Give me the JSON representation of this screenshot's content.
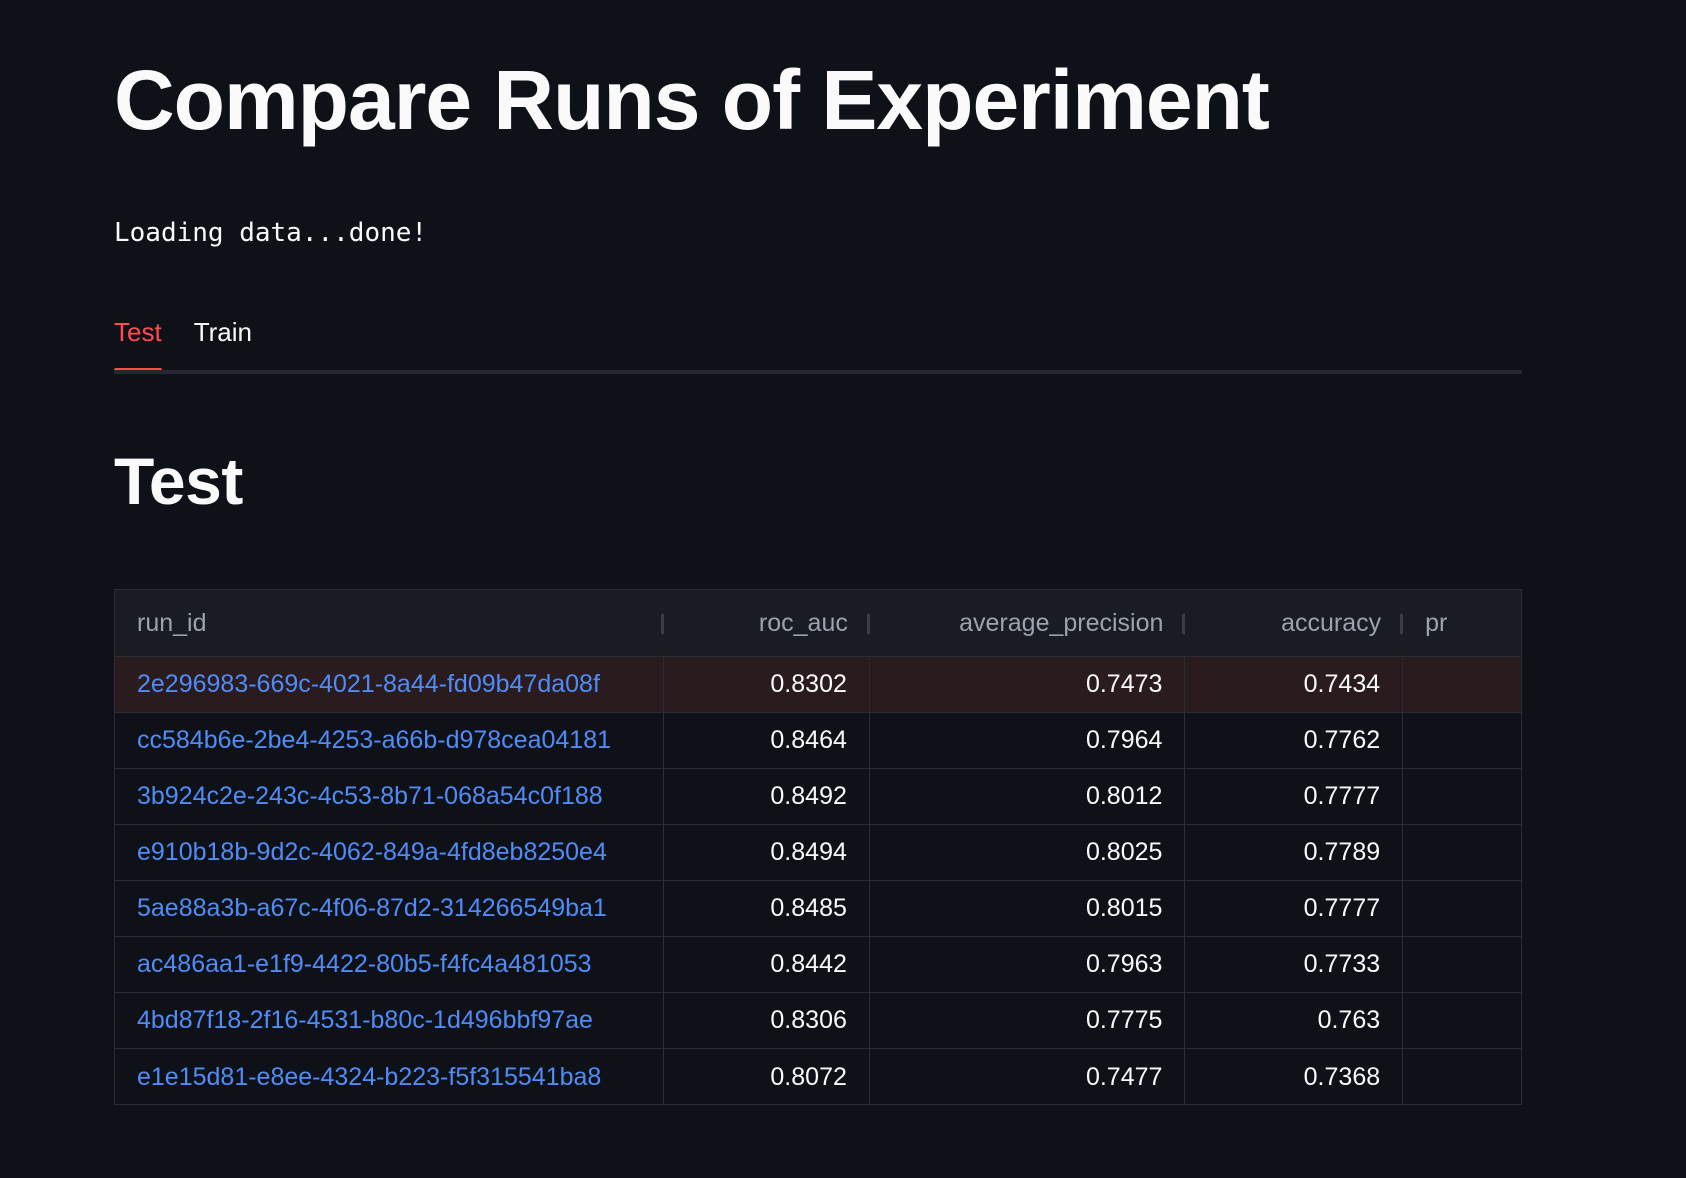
{
  "page": {
    "title": "Compare Runs of Experiment",
    "status": "Loading data...done!",
    "section_title": "Test"
  },
  "tabs": [
    {
      "label": "Test",
      "active": true
    },
    {
      "label": "Train",
      "active": false
    }
  ],
  "colors": {
    "background": "#0e1117",
    "accent": "#ff4b4b",
    "link": "#4f8cf7"
  },
  "table": {
    "columns": [
      "run_id",
      "roc_auc",
      "average_precision",
      "accuracy",
      "pr"
    ],
    "rows": [
      {
        "run_id": "2e296983-669c-4021-8a44-fd09b47da08f",
        "roc_auc": "0.8302",
        "average_precision": "0.7473",
        "accuracy": "0.7434"
      },
      {
        "run_id": "cc584b6e-2be4-4253-a66b-d978cea04181",
        "roc_auc": "0.8464",
        "average_precision": "0.7964",
        "accuracy": "0.7762"
      },
      {
        "run_id": "3b924c2e-243c-4c53-8b71-068a54c0f188",
        "roc_auc": "0.8492",
        "average_precision": "0.8012",
        "accuracy": "0.7777"
      },
      {
        "run_id": "e910b18b-9d2c-4062-849a-4fd8eb8250e4",
        "roc_auc": "0.8494",
        "average_precision": "0.8025",
        "accuracy": "0.7789"
      },
      {
        "run_id": "5ae88a3b-a67c-4f06-87d2-314266549ba1",
        "roc_auc": "0.8485",
        "average_precision": "0.8015",
        "accuracy": "0.7777"
      },
      {
        "run_id": "ac486aa1-e1f9-4422-80b5-f4fc4a481053",
        "roc_auc": "0.8442",
        "average_precision": "0.7963",
        "accuracy": "0.7733"
      },
      {
        "run_id": "4bd87f18-2f16-4531-b80c-1d496bbf97ae",
        "roc_auc": "0.8306",
        "average_precision": "0.7775",
        "accuracy": "0.763"
      },
      {
        "run_id": "e1e15d81-e8ee-4324-b223-f5f315541ba8",
        "roc_auc": "0.8072",
        "average_precision": "0.7477",
        "accuracy": "0.7368"
      }
    ]
  }
}
